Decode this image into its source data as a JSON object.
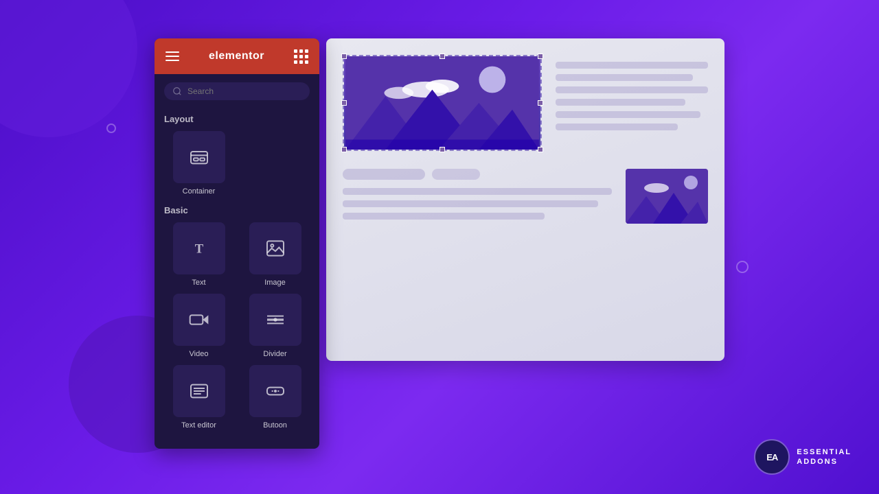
{
  "background": {
    "color": "#5b10d6"
  },
  "header": {
    "title": "elementor",
    "hamburger_label": "menu",
    "grid_label": "apps"
  },
  "search": {
    "placeholder": "Search"
  },
  "layout_section": {
    "label": "Layout",
    "widgets": [
      {
        "id": "container",
        "label": "Container",
        "icon": "container-icon"
      }
    ]
  },
  "basic_section": {
    "label": "Basic",
    "widgets": [
      {
        "id": "text",
        "label": "Text",
        "icon": "text-icon"
      },
      {
        "id": "image",
        "label": "Image",
        "icon": "image-icon"
      },
      {
        "id": "video",
        "label": "Video",
        "icon": "video-icon"
      },
      {
        "id": "divider",
        "label": "Divider",
        "icon": "divider-icon"
      },
      {
        "id": "text-editor",
        "label": "Text editor",
        "icon": "text-editor-icon"
      },
      {
        "id": "button",
        "label": "Butoon",
        "icon": "button-icon"
      }
    ]
  },
  "ea_logo": {
    "badge": "EA",
    "line1": "ESSENTIAL",
    "line2": "ADDONS"
  }
}
